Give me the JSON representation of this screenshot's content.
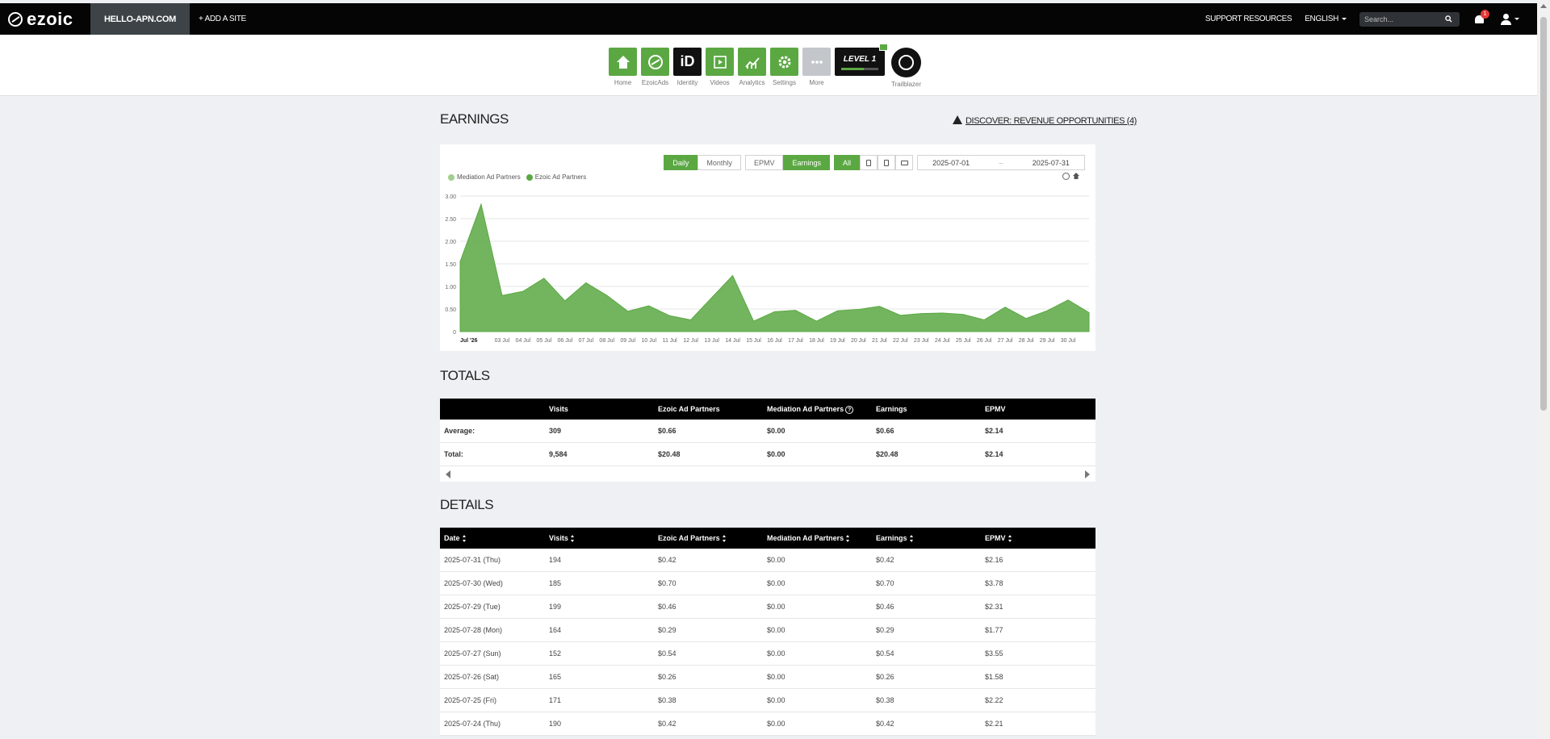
{
  "header": {
    "logo": "ezoic",
    "site": "HELLO-APN.COM",
    "add_site": "+ ADD A SITE",
    "support": "SUPPORT RESOURCES",
    "language": "ENGLISH",
    "search_placeholder": "Search...",
    "notification_count": "1"
  },
  "toolbar": {
    "items": [
      {
        "label": "Home",
        "icon": "house-icon"
      },
      {
        "label": "EzoicAds",
        "icon": "ezoic-ads-icon"
      },
      {
        "label": "Identity",
        "icon": "identity-icon"
      },
      {
        "label": "Videos",
        "icon": "video-play-icon"
      },
      {
        "label": "Analytics",
        "icon": "analytics-chart-icon"
      },
      {
        "label": "Settings",
        "icon": "gear-icon"
      },
      {
        "label": "More",
        "icon": "more-dots-icon"
      }
    ],
    "level_label": "LEVEL 1",
    "level_progress": 0.6,
    "trailblazer_label": "Trailblazer",
    "identity_text": "iD"
  },
  "earnings": {
    "title": "EARNINGS",
    "discover": "DISCOVER: REVENUE OPPORTUNITIES (4)",
    "controls": {
      "daily": "Daily",
      "monthly": "Monthly",
      "epmv": "EPMV",
      "earnings": "Earnings",
      "all": "All",
      "date_from": "2025-07-01",
      "date_sep": "–",
      "date_to": "2025-07-31"
    }
  },
  "chart_data": {
    "type": "area",
    "legend_placement": "top-left",
    "grid": true,
    "series": [
      {
        "name": "Mediation Ad Partners",
        "color": "#a0d08c",
        "values": [
          0,
          0,
          0,
          0,
          0,
          0,
          0,
          0,
          0,
          0,
          0,
          0,
          0,
          0,
          0,
          0,
          0,
          0,
          0,
          0,
          0,
          0,
          0,
          0,
          0,
          0,
          0,
          0,
          0,
          0,
          0
        ]
      },
      {
        "name": "Ezoic Ad Partners",
        "color": "#5ba843",
        "values": [
          1.55,
          2.82,
          0.8,
          0.89,
          1.18,
          0.68,
          1.08,
          0.8,
          0.45,
          0.57,
          0.35,
          0.26,
          0.75,
          1.24,
          0.23,
          0.44,
          0.47,
          0.23,
          0.46,
          0.49,
          0.56,
          0.36,
          0.4,
          0.41,
          0.38,
          0.26,
          0.54,
          0.29,
          0.46,
          0.7,
          0.42
        ]
      }
    ],
    "ylim": [
      0,
      3.0
    ],
    "yticks": [
      "0",
      "0.50",
      "1.00",
      "1.50",
      "2.00",
      "2.50",
      "3.00"
    ],
    "xticks": [
      "Jul '26",
      "03 Jul",
      "04 Jul",
      "05 Jul",
      "06 Jul",
      "07 Jul",
      "08 Jul",
      "09 Jul",
      "10 Jul",
      "11 Jul",
      "12 Jul",
      "13 Jul",
      "14 Jul",
      "15 Jul",
      "16 Jul",
      "17 Jul",
      "18 Jul",
      "19 Jul",
      "20 Jul",
      "21 Jul",
      "22 Jul",
      "23 Jul",
      "24 Jul",
      "25 Jul",
      "26 Jul",
      "27 Jul",
      "28 Jul",
      "29 Jul",
      "30 Jul"
    ]
  },
  "totals": {
    "title": "TOTALS",
    "headers": [
      "",
      "Visits",
      "Ezoic Ad Partners",
      "Mediation Ad Partners",
      "Earnings",
      "EPMV"
    ],
    "rows": [
      [
        "Average:",
        "309",
        "$0.66",
        "$0.00",
        "$0.66",
        "$2.14"
      ],
      [
        "Total:",
        "9,584",
        "$20.48",
        "$0.00",
        "$20.48",
        "$2.14"
      ]
    ]
  },
  "details": {
    "title": "DETAILS",
    "headers": [
      "Date",
      "Visits",
      "Ezoic Ad Partners",
      "Mediation Ad Partners",
      "Earnings",
      "EPMV"
    ],
    "rows": [
      [
        "2025-07-31 (Thu)",
        "194",
        "$0.42",
        "$0.00",
        "$0.42",
        "$2.16"
      ],
      [
        "2025-07-30 (Wed)",
        "185",
        "$0.70",
        "$0.00",
        "$0.70",
        "$3.78"
      ],
      [
        "2025-07-29 (Tue)",
        "199",
        "$0.46",
        "$0.00",
        "$0.46",
        "$2.31"
      ],
      [
        "2025-07-28 (Mon)",
        "164",
        "$0.29",
        "$0.00",
        "$0.29",
        "$1.77"
      ],
      [
        "2025-07-27 (Sun)",
        "152",
        "$0.54",
        "$0.00",
        "$0.54",
        "$3.55"
      ],
      [
        "2025-07-26 (Sat)",
        "165",
        "$0.26",
        "$0.00",
        "$0.26",
        "$1.58"
      ],
      [
        "2025-07-25 (Fri)",
        "171",
        "$0.38",
        "$0.00",
        "$0.38",
        "$2.22"
      ],
      [
        "2025-07-24 (Thu)",
        "190",
        "$0.42",
        "$0.00",
        "$0.42",
        "$2.21"
      ]
    ]
  }
}
